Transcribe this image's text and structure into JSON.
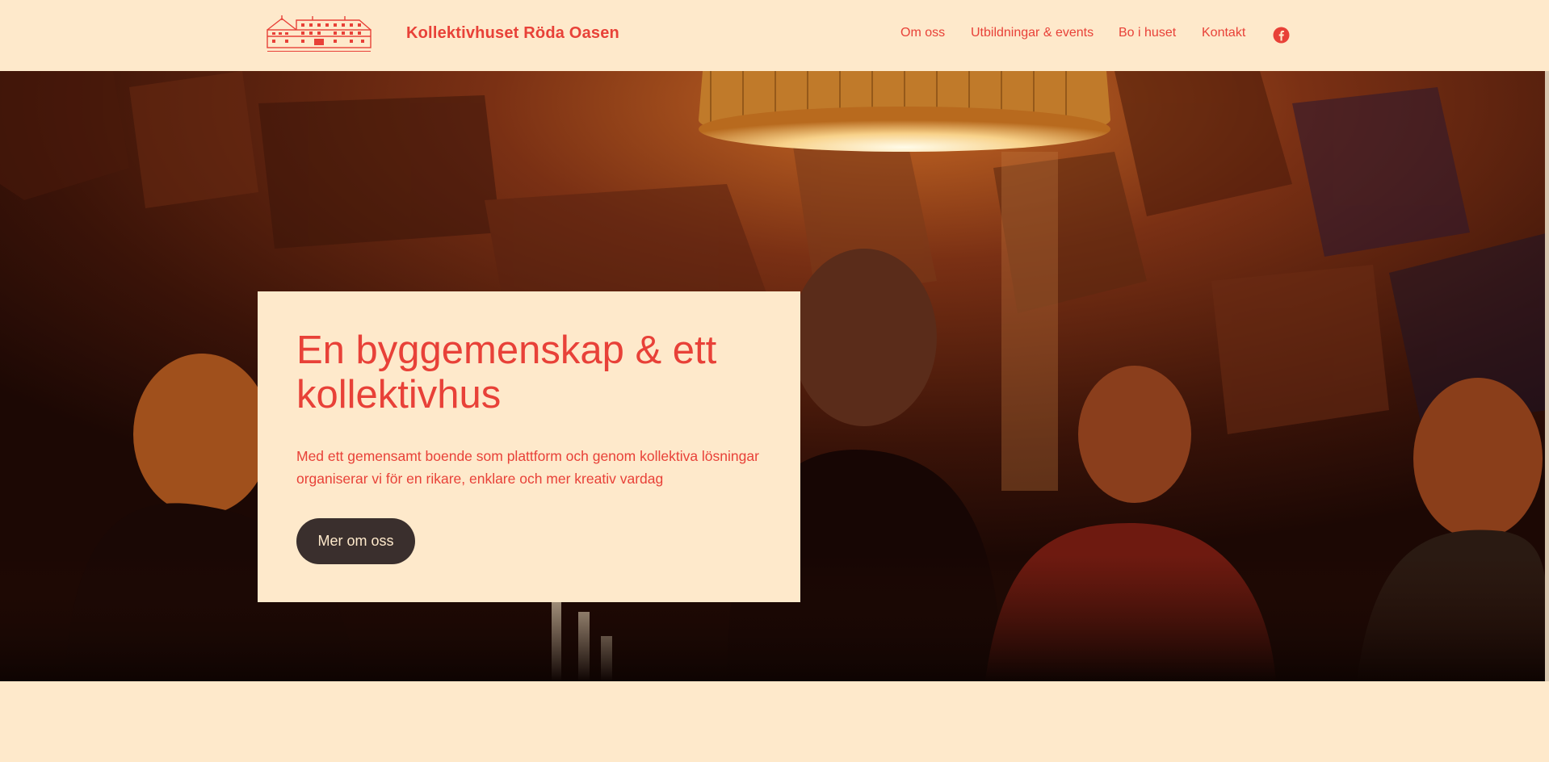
{
  "header": {
    "logo_alt": "Kollektivhuset Röda Oasen logo",
    "site_title": "Kollektivhuset Röda Oasen",
    "nav": [
      {
        "label": "Om oss"
      },
      {
        "label": "Utbildningar & events"
      },
      {
        "label": "Bo i huset"
      },
      {
        "label": "Kontakt"
      }
    ],
    "social_icon": "facebook-icon"
  },
  "hero": {
    "title": "En byggemenskap & ett kollektivhus",
    "text": "Med ett gemensamt boende som plattform och genom kollektiva lösningar organiserar vi för en rikare, enklare och mer kreativ vardag",
    "button_label": "Mer om oss"
  },
  "colors": {
    "background": "#fee9cb",
    "accent": "#e84138",
    "button": "#3a2f2d"
  }
}
